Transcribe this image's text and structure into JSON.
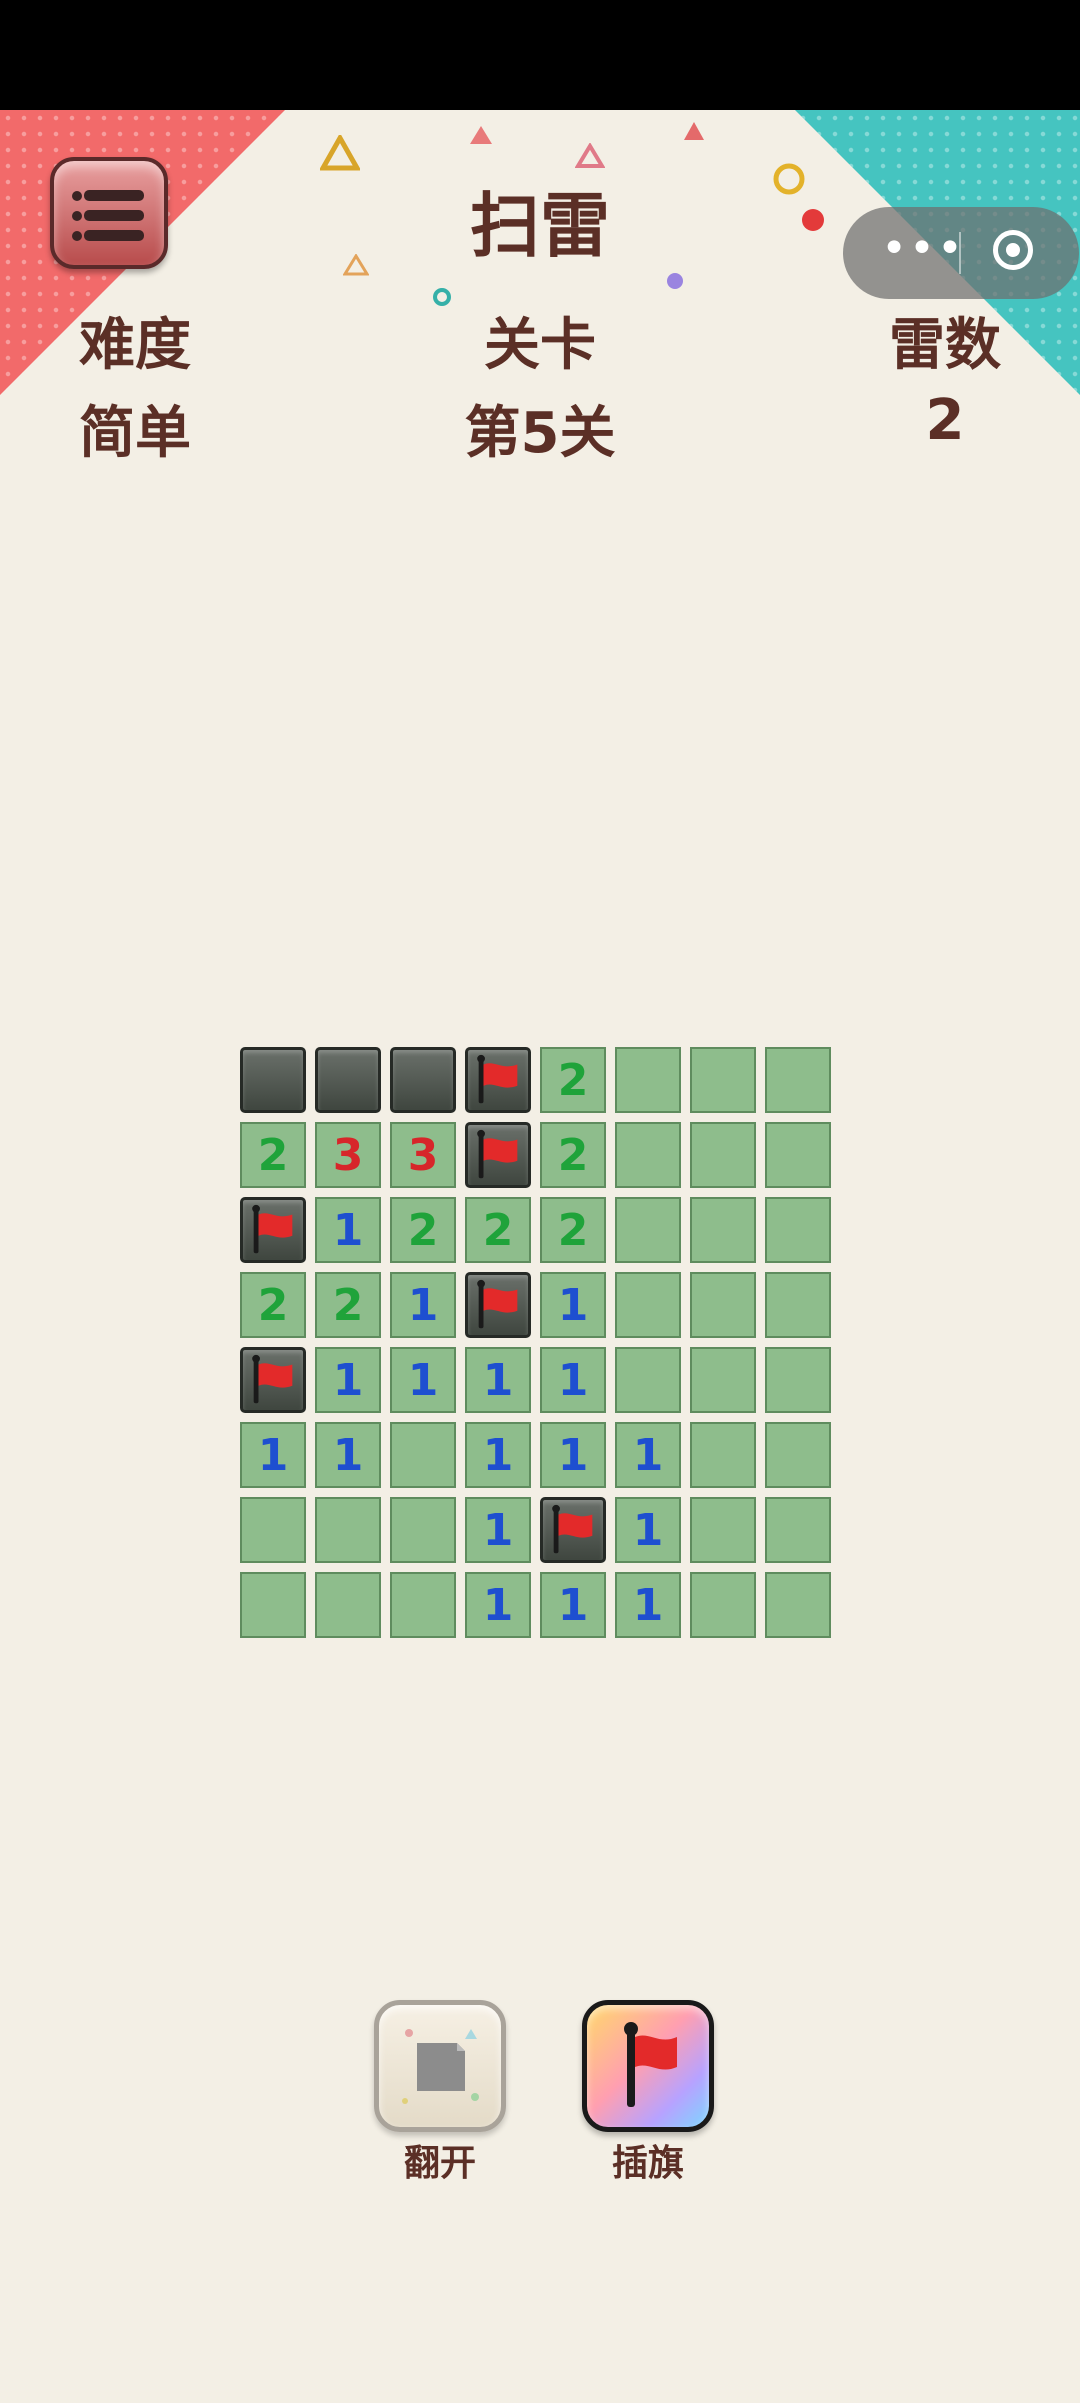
{
  "header": {
    "title": "扫雷",
    "difficulty_label": "难度",
    "difficulty_value": "简单",
    "level_label": "关卡",
    "level_value": "第5关",
    "mines_label": "雷数",
    "mines_value": "2"
  },
  "colors": {
    "background": "#f3efe5",
    "text_brown": "#5b2f26",
    "cell_green": "#8ebd8c",
    "hidden_cell": "#4b524b",
    "corner_red": "#f26a6a",
    "corner_teal": "#45c4c0",
    "num1": "#1e4fd0",
    "num2": "#1fa33a",
    "num3": "#d7262a"
  },
  "board": {
    "rows": 8,
    "cols": 8,
    "cells": [
      [
        "H",
        "H",
        "H",
        "F",
        "2",
        "",
        "",
        ""
      ],
      [
        "2",
        "3",
        "3",
        "F",
        "2",
        "",
        "",
        ""
      ],
      [
        "F",
        "1",
        "2",
        "2",
        "2",
        "",
        "",
        ""
      ],
      [
        "2",
        "2",
        "1",
        "F",
        "1",
        "",
        "",
        ""
      ],
      [
        "F",
        "1",
        "1",
        "1",
        "1",
        "",
        "",
        ""
      ],
      [
        "1",
        "1",
        "",
        "1",
        "1",
        "1",
        "",
        ""
      ],
      [
        "",
        "",
        "",
        "1",
        "F",
        "1",
        "",
        ""
      ],
      [
        "",
        "",
        "",
        "1",
        "1",
        "1",
        "",
        ""
      ]
    ]
  },
  "tools": {
    "open_label": "翻开",
    "flag_label": "插旗"
  },
  "icons": {
    "menu": "menu-list-icon",
    "more": "more-dots-icon",
    "close": "target-circle-icon",
    "flag": "red-flag-icon",
    "open_tile": "tile-icon"
  }
}
